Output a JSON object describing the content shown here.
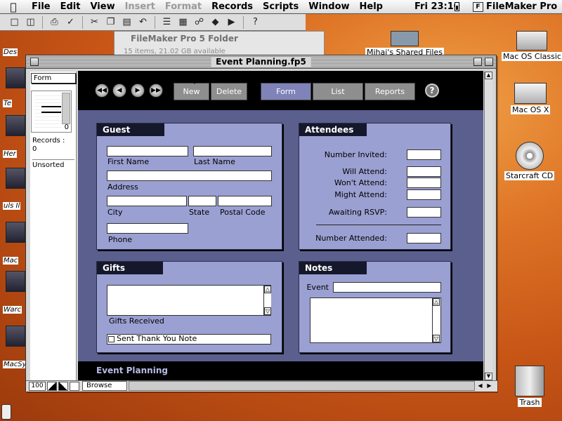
{
  "menubar": {
    "items": [
      "File",
      "Edit",
      "View",
      "Insert",
      "Format",
      "Records",
      "Scripts",
      "Window",
      "Help"
    ],
    "disabled": [
      "Insert",
      "Format"
    ],
    "clock": "Fri 23:10",
    "app_name": "FileMaker Pro"
  },
  "toolbar": {
    "buttons": [
      "new-doc-icon",
      "open-icon",
      "print-icon",
      "spell-check-icon",
      "cut-icon",
      "copy-icon",
      "paste-icon",
      "undo-icon",
      "sort-icon",
      "find-icon",
      "script-icon",
      "omit-icon",
      "help-icon"
    ]
  },
  "folder_window": {
    "title": "FileMaker Pro 5 Folder",
    "info": "15 items, 21.02 GB available"
  },
  "desktop_icons": {
    "mac_os_classic": "Mac OS Classic",
    "mac_os_x": "Mac OS X",
    "starcraft": "Starcraft CD",
    "trash": "Trash",
    "shared_files": "Mihai's Shared Files"
  },
  "left_labels": [
    "Des",
    "Te",
    "Her",
    "uls Il",
    "Mac",
    "Warc",
    "MacSy"
  ],
  "window": {
    "title": "Event Planning.fp5"
  },
  "status": {
    "layout": "Form",
    "records_label": "Records :",
    "records_count": "0",
    "book_count": "0",
    "sort": "Unsorted",
    "zoom": "100",
    "mode": "Browse"
  },
  "nav": {
    "buttons": {
      "new": "New",
      "delete": "Delete",
      "form": "Form",
      "list": "List",
      "reports": "Reports"
    },
    "help": "?"
  },
  "guest": {
    "header": "Guest",
    "first_name": "First Name",
    "last_name": "Last Name",
    "address": "Address",
    "city": "City",
    "state": "State",
    "postal_code": "Postal Code",
    "phone": "Phone"
  },
  "attendees": {
    "header": "Attendees",
    "number_invited": "Number Invited:",
    "will_attend": "Will Attend:",
    "wont_attend": "Won't Attend:",
    "might_attend": "Might Attend:",
    "awaiting_rsvp": "Awaiting RSVP:",
    "number_attended": "Number Attended:"
  },
  "gifts": {
    "header": "Gifts",
    "gifts_received": "Gifts Received",
    "thank_you": "Sent Thank You Note"
  },
  "notes": {
    "header": "Notes",
    "event": "Event"
  },
  "footer": {
    "title": "Event Planning"
  }
}
